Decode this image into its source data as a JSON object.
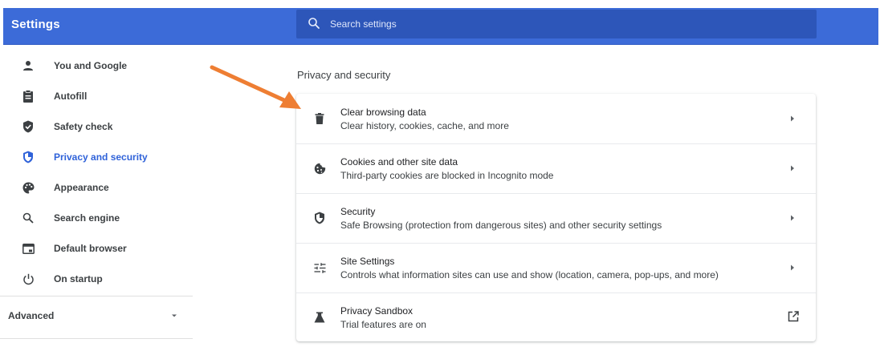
{
  "header": {
    "title": "Settings",
    "search": {
      "placeholder": "Search settings",
      "value": ""
    }
  },
  "colors": {
    "header_bg": "#3c6bd8",
    "search_bg": "#2d56b9",
    "active": "#2f62d9",
    "annotation_arrow": "#ee7e33"
  },
  "sidebar": {
    "items": [
      {
        "label": "You and Google",
        "icon": "person-icon",
        "active": false
      },
      {
        "label": "Autofill",
        "icon": "clipboard-icon",
        "active": false
      },
      {
        "label": "Safety check",
        "icon": "shield-check-icon",
        "active": false
      },
      {
        "label": "Privacy and security",
        "icon": "shield-half-icon",
        "active": true
      },
      {
        "label": "Appearance",
        "icon": "palette-icon",
        "active": false
      },
      {
        "label": "Search engine",
        "icon": "search-icon",
        "active": false
      },
      {
        "label": "Default browser",
        "icon": "browser-window-icon",
        "active": false
      },
      {
        "label": "On startup",
        "icon": "power-icon",
        "active": false
      }
    ],
    "advanced_label": "Advanced"
  },
  "main": {
    "section_title": "Privacy and security",
    "rows": [
      {
        "title": "Clear browsing data",
        "subtitle": "Clear history, cookies, cache, and more",
        "icon": "trash-icon",
        "action": "chevron-right-icon"
      },
      {
        "title": "Cookies and other site data",
        "subtitle": "Third-party cookies are blocked in Incognito mode",
        "icon": "cookie-icon",
        "action": "chevron-right-icon"
      },
      {
        "title": "Security",
        "subtitle": "Safe Browsing (protection from dangerous sites) and other security settings",
        "icon": "shield-half-icon",
        "action": "chevron-right-icon"
      },
      {
        "title": "Site Settings",
        "subtitle": "Controls what information sites can use and show (location, camera, pop-ups, and more)",
        "icon": "sliders-icon",
        "action": "chevron-right-icon"
      },
      {
        "title": "Privacy Sandbox",
        "subtitle": "Trial features are on",
        "icon": "flask-icon",
        "action": "external-link-icon"
      }
    ]
  }
}
